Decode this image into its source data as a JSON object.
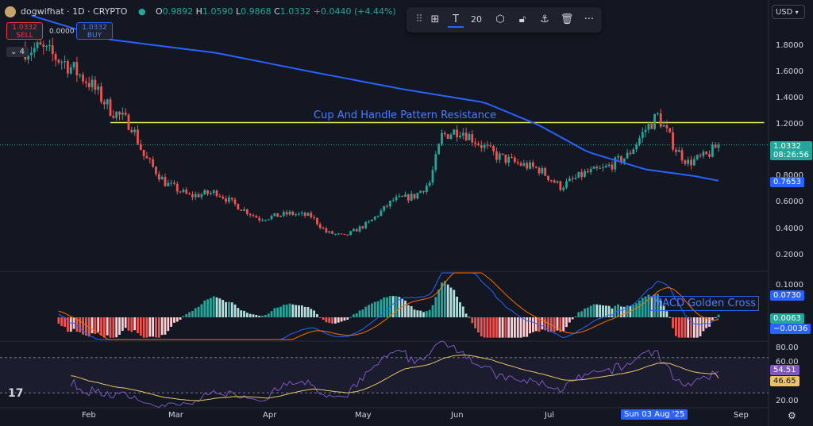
{
  "header": {
    "symbol": "dogwifhat · 1D · CRYPTO",
    "open_label": "O",
    "open": "0.9892",
    "high_label": "H",
    "high": "1.0590",
    "low_label": "L",
    "low": "0.9868",
    "close_label": "C",
    "close": "1.0332",
    "change": "+0.0440 (+4.44%)"
  },
  "trade": {
    "sell_price": "1.0332",
    "sell_label": "SELL",
    "spread": "0.0000",
    "buy_price": "1.0332",
    "buy_label": "BUY",
    "indicator_count": "4"
  },
  "toolbar": {
    "line_width": "20"
  },
  "currency": "USD",
  "colors": {
    "background": "#131722",
    "up": "#26a69a",
    "down": "#ef5350",
    "ma_line": "#2962ff",
    "resistance": "#e8e84a",
    "macd_line": "#2962ff",
    "signal_line": "#ff6d00",
    "rsi_line": "#7e57c2",
    "rsi_ma": "#e8c36a"
  },
  "annotations": {
    "resistance_text": "Cup And Handle Pattern Resistance",
    "macd_text": "MACD Golden Cross"
  },
  "price_axis": {
    "ticks": [
      "1.8000",
      "1.6000",
      "1.4000",
      "1.2000",
      "0.8000",
      "0.6000",
      "0.4000",
      "0.2000"
    ],
    "last_price": "1.0332",
    "countdown": "08:26:56",
    "ma_value": "0.7653"
  },
  "macd_axis": {
    "ticks": [
      "0.1000"
    ],
    "macd_value": "0.0730",
    "hist_value": "0.0063",
    "signal_value": "−0.0036"
  },
  "rsi_axis": {
    "ticks": [
      "80.00",
      "60.00",
      "40.00",
      "20.00"
    ],
    "rsi_value": "54.51",
    "rsi_ma_value": "46.65"
  },
  "time_axis": {
    "labels": [
      "Feb",
      "Mar",
      "Apr",
      "May",
      "Jun",
      "Jul",
      "Sep"
    ],
    "crosshair_date": "Sun 03 Aug '25"
  },
  "chart_data": {
    "type": "candlestick",
    "ylim": [
      0.1,
      1.95
    ],
    "resistance_level": 1.2,
    "close_anchors": [
      [
        "2025-01-02",
        1.75
      ],
      [
        "2025-01-10",
        1.65
      ],
      [
        "2025-01-18",
        1.5
      ],
      [
        "2025-01-25",
        1.3
      ],
      [
        "2025-02-01",
        1.18
      ],
      [
        "2025-02-05",
        0.95
      ],
      [
        "2025-02-12",
        0.75
      ],
      [
        "2025-02-20",
        0.65
      ],
      [
        "2025-03-01",
        0.68
      ],
      [
        "2025-03-06",
        0.6
      ],
      [
        "2025-03-15",
        0.48
      ],
      [
        "2025-03-25",
        0.52
      ],
      [
        "2025-04-01",
        0.5
      ],
      [
        "2025-04-06",
        0.38
      ],
      [
        "2025-04-12",
        0.35
      ],
      [
        "2025-04-20",
        0.45
      ],
      [
        "2025-04-28",
        0.62
      ],
      [
        "2025-05-05",
        0.65
      ],
      [
        "2025-05-10",
        0.75
      ],
      [
        "2025-05-14",
        1.1
      ],
      [
        "2025-05-20",
        1.15
      ],
      [
        "2025-05-26",
        1.05
      ],
      [
        "2025-06-01",
        0.95
      ],
      [
        "2025-06-07",
        0.9
      ],
      [
        "2025-06-15",
        0.85
      ],
      [
        "2025-06-22",
        0.72
      ],
      [
        "2025-06-30",
        0.82
      ],
      [
        "2025-07-06",
        0.85
      ],
      [
        "2025-07-14",
        0.95
      ],
      [
        "2025-07-20",
        1.15
      ],
      [
        "2025-07-24",
        1.25
      ],
      [
        "2025-07-30",
        1.0
      ],
      [
        "2025-08-03",
        0.9
      ],
      [
        "2025-08-09",
        0.95
      ],
      [
        "2025-08-13",
        1.0332
      ]
    ],
    "ma_anchors": [
      [
        "2024-12-30",
        2.0
      ],
      [
        "2025-01-25",
        1.82
      ],
      [
        "2025-03-01",
        1.72
      ],
      [
        "2025-04-01",
        1.58
      ],
      [
        "2025-05-01",
        1.45
      ],
      [
        "2025-05-28",
        1.35
      ],
      [
        "2025-06-15",
        1.18
      ],
      [
        "2025-07-01",
        0.98
      ],
      [
        "2025-07-20",
        0.85
      ],
      [
        "2025-08-05",
        0.8
      ],
      [
        "2025-08-13",
        0.7653
      ]
    ],
    "macd": {
      "macd": 0.073,
      "signal": -0.0036,
      "histogram": 0.0063,
      "ylim": [
        -0.06,
        0.12
      ]
    },
    "rsi": {
      "value": 54.51,
      "ma": 46.65,
      "ylim": [
        15,
        85
      ],
      "bands": [
        70,
        30
      ]
    }
  }
}
